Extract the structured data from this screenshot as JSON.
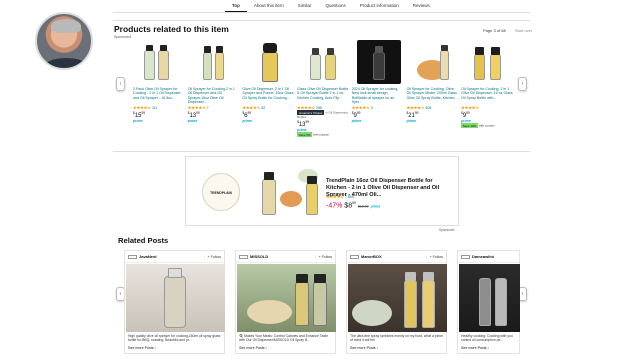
{
  "nav": {
    "tabs": [
      "Top",
      "About this item",
      "Similar",
      "Questions",
      "Product information",
      "Reviews"
    ]
  },
  "products_section": {
    "title": "Products related to this item",
    "sponsored": "Sponsored",
    "page_indicator": "Page 3 of 58",
    "start_over": "Start over",
    "prev_arrow": "‹",
    "next_arrow": "›",
    "items": [
      {
        "title": "2 Pack Olive Oil Sprayer for Cooking - 2 in 1 Oil Dispenser and Oil Sprayer - 16.5oz...",
        "stars": "★★★★☆",
        "reviews": "111",
        "price_whole": "15",
        "price_frac": "99",
        "prime": "prime"
      },
      {
        "title": "Oil Sprayer for Cooking,2 in 1 Oil Dispenser and Oil Sprayer,16oz Olive Oil Dispenser...",
        "stars": "★★★★☆",
        "reviews": "7",
        "price_whole": "13",
        "price_frac": "99",
        "prime": "prime"
      },
      {
        "title": "Olive Oil Dispenser, 2 in 1 Oil Sprayer and Pourer, 16oz Glass Oil Spray Bottle for Cooking...",
        "stars": "★★★★☆",
        "reviews": "52",
        "price_whole": "6",
        "price_frac": "99",
        "prime": "prime"
      },
      {
        "title": "Glass Olive Oil Dispenser Bottle & Oil Sprayer Bottle 2 in 1 for Kitchen Cooking, Auto Flip...",
        "stars": "★★★★☆",
        "reviews": "265",
        "badge": "Amazon's Choice",
        "badge_suffix": "in Oil Dispensing Bottles",
        "price_whole": "13",
        "price_frac": "99",
        "prime": "prime",
        "save": "Save 5%",
        "coupon": "with coupon"
      },
      {
        "title": "2024 Oil Sprayer for cooking, New look small design, Refillable oil sprayer for air fryer...",
        "stars": "★★★★☆",
        "reviews": "3",
        "price_whole": "9",
        "price_frac": "99",
        "prime": "prime"
      },
      {
        "title": "Oil Sprayer for Cooking, Olive Oil Sprayer Mister, 200ml Glass Olive Oil Spray Bottle, Kitchen...",
        "stars": "★★★★☆",
        "reviews": "605",
        "price_whole": "21",
        "price_frac": "99",
        "prime": "prime"
      },
      {
        "title": "Oil Sprayer for Cooking, 2 in 1 Olive Oil Dispenser, 16 oz Glass Oil Spray Bottle with...",
        "stars": "★★★★☆",
        "reviews": "",
        "price_whole": "9",
        "price_frac": "99",
        "prime": "prime",
        "save": "Save 10%",
        "coupon": "with coupon"
      }
    ]
  },
  "ad": {
    "logo_text": "TRENDPLAIN",
    "title": "TrendPlain 16oz Oil Dispenser Bottle for Kitchen - 2 in 1 Olive Oil Dispenser and Oil Sprayer - 470ml Oli...",
    "stars": "★★★★☆",
    "reviews": "7,895",
    "discount": "-47%",
    "price": "$8",
    "price_frac": "99",
    "old_price": "$16.99",
    "prime": "prime",
    "sponsored": "Sponsored"
  },
  "related_posts": {
    "title": "Related Posts",
    "prev_arrow": "‹",
    "next_arrow": "›",
    "posts": [
      {
        "brand": "JavaNest",
        "follow": "+ Follow",
        "text": "High quality olive oil sprayer for cooking,180ml oil spray glass bottle for BBQ, roasting, Beautiful and pr...",
        "more": "See more Posts ›"
      },
      {
        "brand": "MISSOLD",
        "follow": "+ Follow",
        "text": "🍳 Makes Your Meals: Control Calories and Enhance Taste with Our Oil Dispenser!MISSOLD Oil Spray B...",
        "more": "See more Posts ›"
      },
      {
        "brand": "ManorBOX",
        "follow": "+ Follow",
        "text": "The ultra-fine spray sprinkles evenly on my food, what a piece of mind it will be!",
        "more": "See more Posts ›"
      },
      {
        "brand": "Dameawlini",
        "follow": "",
        "text": "Healthy cooking. Cooking with you control oil consumption pe...",
        "more": "See more Posts ›"
      }
    ]
  }
}
